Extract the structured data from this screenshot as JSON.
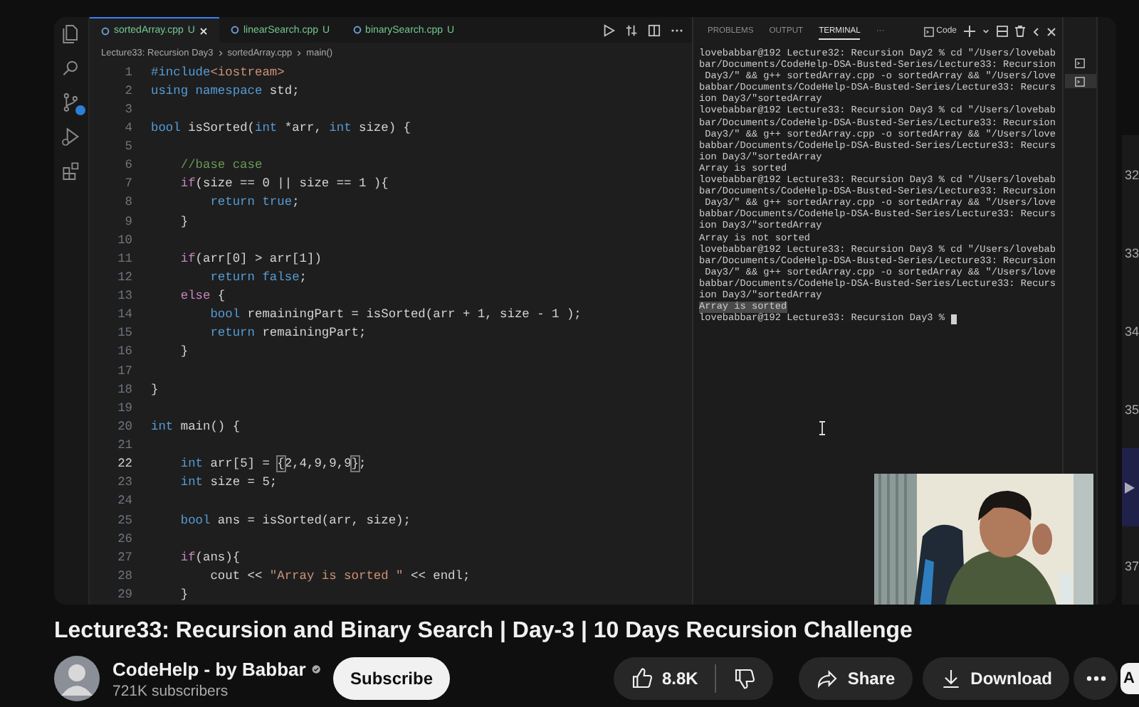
{
  "activity_bar": {
    "items": [
      {
        "kind": "files",
        "badge": false
      },
      {
        "kind": "search",
        "badge": false
      },
      {
        "kind": "source-control",
        "badge": true
      },
      {
        "kind": "run",
        "badge": false
      },
      {
        "kind": "extensions",
        "badge": false
      }
    ]
  },
  "editor": {
    "tabs": [
      {
        "label": "sortedArray.cpp",
        "status": "U",
        "selected": true
      },
      {
        "label": "linearSearch.cpp",
        "status": "U",
        "selected": false
      },
      {
        "label": "binarySearch.cpp",
        "status": "U",
        "selected": false
      }
    ],
    "breadcrumb": [
      "Lecture33: Recursion Day3",
      "sortedArray.cpp",
      "main()"
    ],
    "lines": [
      {
        "number": "1",
        "active": false,
        "tokens": [
          {
            "kind": "kw",
            "text": "#include"
          },
          {
            "kind": "str",
            "text": "<iostream>"
          }
        ]
      },
      {
        "number": "2",
        "active": false,
        "tokens": [
          {
            "kind": "kw",
            "text": "using"
          },
          {
            "kind": "kw",
            "text": " namespace"
          },
          {
            "kind": "plain",
            "text": " std;"
          }
        ]
      },
      {
        "number": "3",
        "active": false
      },
      {
        "number": "4",
        "active": false,
        "tokens": [
          {
            "kind": "kw",
            "text": "bool"
          },
          {
            "kind": "plain",
            "text": " isSorted("
          },
          {
            "kind": "kw",
            "text": "int"
          },
          {
            "kind": "plain",
            "text": " *arr, "
          },
          {
            "kind": "kw",
            "text": "int"
          },
          {
            "kind": "plain",
            "text": " size) {"
          }
        ]
      },
      {
        "number": "5",
        "active": false
      },
      {
        "number": "6",
        "active": false,
        "tokens": [
          {
            "kind": "cmt",
            "text": "    //base case"
          }
        ]
      },
      {
        "number": "7",
        "active": false,
        "tokens": [
          {
            "kind": "ctrl",
            "text": "    if"
          },
          {
            "kind": "plain",
            "text": "(size == 0 || size == 1 ){"
          }
        ]
      },
      {
        "number": "8",
        "active": false,
        "tokens": [
          {
            "kind": "kw",
            "text": "        return"
          },
          {
            "kind": "kw",
            "text": " true"
          },
          {
            "kind": "plain",
            "text": ";"
          }
        ]
      },
      {
        "number": "9",
        "active": false,
        "tokens": [
          {
            "kind": "plain",
            "text": "    }"
          }
        ]
      },
      {
        "number": "10",
        "active": false
      },
      {
        "number": "11",
        "active": false,
        "tokens": [
          {
            "kind": "ctrl",
            "text": "    if"
          },
          {
            "kind": "plain",
            "text": "(arr[0] > arr[1])"
          }
        ]
      },
      {
        "number": "12",
        "active": false,
        "tokens": [
          {
            "kind": "kw",
            "text": "        return"
          },
          {
            "kind": "kw",
            "text": " false"
          },
          {
            "kind": "plain",
            "text": ";"
          }
        ]
      },
      {
        "number": "13",
        "active": false,
        "tokens": [
          {
            "kind": "ctrl",
            "text": "    else"
          },
          {
            "kind": "plain",
            "text": " {"
          }
        ]
      },
      {
        "number": "14",
        "active": false,
        "tokens": [
          {
            "kind": "kw",
            "text": "        bool"
          },
          {
            "kind": "plain",
            "text": " remainingPart = isSorted(arr + 1, size - 1 );"
          }
        ]
      },
      {
        "number": "15",
        "active": false,
        "tokens": [
          {
            "kind": "kw",
            "text": "        return"
          },
          {
            "kind": "plain",
            "text": " remainingPart;"
          }
        ]
      },
      {
        "number": "16",
        "active": false,
        "tokens": [
          {
            "kind": "plain",
            "text": "    }"
          }
        ]
      },
      {
        "number": "17",
        "active": false
      },
      {
        "number": "18",
        "active": false,
        "tokens": [
          {
            "kind": "plain",
            "text": "}"
          }
        ]
      },
      {
        "number": "19",
        "active": false
      },
      {
        "number": "20",
        "active": false,
        "tokens": [
          {
            "kind": "kw",
            "text": "int"
          },
          {
            "kind": "plain",
            "text": " main() {"
          }
        ]
      },
      {
        "number": "21",
        "active": false
      },
      {
        "number": "22",
        "active": true,
        "tokens": [
          {
            "kind": "kw",
            "text": "    int"
          },
          {
            "kind": "plain",
            "text": " arr[5] = "
          },
          {
            "kind": "bracket",
            "text": "{"
          },
          {
            "kind": "plain",
            "text": "2,4,9,9,9"
          },
          {
            "kind": "bracket",
            "text": "}"
          },
          {
            "kind": "plain",
            "text": ";"
          }
        ]
      },
      {
        "number": "23",
        "active": false,
        "tokens": [
          {
            "kind": "kw",
            "text": "    int"
          },
          {
            "kind": "plain",
            "text": " size = 5;"
          }
        ]
      },
      {
        "number": "24",
        "active": false
      },
      {
        "number": "25",
        "active": false,
        "tokens": [
          {
            "kind": "kw",
            "text": "    bool"
          },
          {
            "kind": "plain",
            "text": " ans = isSorted(arr, size);"
          }
        ]
      },
      {
        "number": "26",
        "active": false
      },
      {
        "number": "27",
        "active": false,
        "tokens": [
          {
            "kind": "ctrl",
            "text": "    if"
          },
          {
            "kind": "plain",
            "text": "(ans){"
          }
        ]
      },
      {
        "number": "28",
        "active": false,
        "tokens": [
          {
            "kind": "plain",
            "text": "        cout << "
          },
          {
            "kind": "str",
            "text": "\"Array is sorted \""
          },
          {
            "kind": "plain",
            "text": " << endl;"
          }
        ]
      },
      {
        "number": "29",
        "active": false,
        "tokens": [
          {
            "kind": "plain",
            "text": "    }"
          }
        ]
      }
    ]
  },
  "terminal_panel": {
    "tabs": [
      {
        "label": "PROBLEMS",
        "selected": false
      },
      {
        "label": "OUTPUT",
        "selected": false
      },
      {
        "label": "TERMINAL",
        "selected": true
      },
      {
        "label": "···",
        "selected": false
      }
    ],
    "profile": "Code",
    "cursor": true,
    "lines": [
      {
        "text": "lovebabbar@192 Lecture32: Recursion Day2 % cd \"/Users/lovebab",
        "selected": false
      },
      {
        "text": "bar/Documents/CodeHelp-DSA-Busted-Series/Lecture33: Recursion",
        "selected": false
      },
      {
        "text": " Day3/\" && g++ sortedArray.cpp -o sortedArray && \"/Users/love",
        "selected": false
      },
      {
        "text": "babbar/Documents/CodeHelp-DSA-Busted-Series/Lecture33: Recurs",
        "selected": false
      },
      {
        "text": "ion Day3/\"sortedArray",
        "selected": false
      },
      {
        "text": "lovebabbar@192 Lecture33: Recursion Day3 % cd \"/Users/lovebab",
        "selected": false
      },
      {
        "text": "bar/Documents/CodeHelp-DSA-Busted-Series/Lecture33: Recursion",
        "selected": false
      },
      {
        "text": " Day3/\" && g++ sortedArray.cpp -o sortedArray && \"/Users/love",
        "selected": false
      },
      {
        "text": "babbar/Documents/CodeHelp-DSA-Busted-Series/Lecture33: Recurs",
        "selected": false
      },
      {
        "text": "ion Day3/\"sortedArray",
        "selected": false
      },
      {
        "text": "Array is sorted",
        "selected": false
      },
      {
        "text": "lovebabbar@192 Lecture33: Recursion Day3 % cd \"/Users/lovebab",
        "selected": false
      },
      {
        "text": "bar/Documents/CodeHelp-DSA-Busted-Series/Lecture33: Recursion",
        "selected": false
      },
      {
        "text": " Day3/\" && g++ sortedArray.cpp -o sortedArray && \"/Users/love",
        "selected": false
      },
      {
        "text": "babbar/Documents/CodeHelp-DSA-Busted-Series/Lecture33: Recurs",
        "selected": false
      },
      {
        "text": "ion Day3/\"sortedArray",
        "selected": false
      },
      {
        "text": "Array is not sorted",
        "selected": false
      },
      {
        "text": "lovebabbar@192 Lecture33: Recursion Day3 % cd \"/Users/lovebab",
        "selected": false
      },
      {
        "text": "bar/Documents/CodeHelp-DSA-Busted-Series/Lecture33: Recursion",
        "selected": false
      },
      {
        "text": " Day3/\" && g++ sortedArray.cpp -o sortedArray && \"/Users/love",
        "selected": false
      },
      {
        "text": "babbar/Documents/CodeHelp-DSA-Busted-Series/Lecture33: Recurs",
        "selected": false
      },
      {
        "text": "ion Day3/\"sortedArray",
        "selected": false
      },
      {
        "text": "Array is sorted",
        "selected": true
      },
      {
        "text": "lovebabbar@192 Lecture33: Recursion Day3 %",
        "selected": false
      }
    ]
  },
  "playlist": {
    "items": [
      {
        "index": "32",
        "selected": false
      },
      {
        "index": "33",
        "selected": false
      },
      {
        "index": "34",
        "selected": false
      },
      {
        "index": "35",
        "selected": false
      },
      {
        "selected": true
      },
      {
        "index": "37",
        "selected": false
      }
    ]
  },
  "video_info": {
    "title": "Lecture33: Recursion and Binary Search | Day-3 | 10 Days Recursion Challenge",
    "channel": {
      "name": "CodeHelp - by Babbar",
      "verified": true,
      "subscribers": "721K subscribers"
    },
    "subscribe": "Subscribe",
    "likes": "8.8K",
    "share": "Share",
    "download": "Download",
    "chip": "A"
  }
}
